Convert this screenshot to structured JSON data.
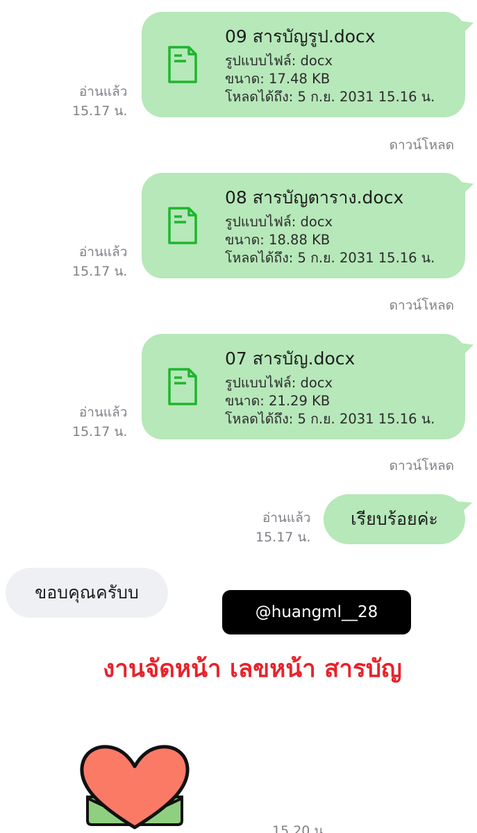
{
  "messages": {
    "files": [
      {
        "title": "09 สารบัญรูป.docx",
        "format": "รูปแบบไฟล์: docx",
        "size": "ขนาด: 17.48 KB",
        "expiry": "โหลดได้ถึง: 5 ก.ย. 2031 15.16 น.",
        "read_status": "อ่านแล้ว",
        "read_time": "15.17 น.",
        "download_label": "ดาวน์โหลด"
      },
      {
        "title": "08 สารบัญตาราง.docx",
        "format": "รูปแบบไฟล์: docx",
        "size": "ขนาด: 18.88 KB",
        "expiry": "โหลดได้ถึง: 5 ก.ย. 2031 15.16 น.",
        "read_status": "อ่านแล้ว",
        "read_time": "15.17 น.",
        "download_label": "ดาวน์โหลด"
      },
      {
        "title": "07 สารบัญ.docx",
        "format": "รูปแบบไฟล์: docx",
        "size": "ขนาด: 21.29 KB",
        "expiry": "โหลดได้ถึง: 5 ก.ย. 2031 15.16 น.",
        "read_status": "อ่านแล้ว",
        "read_time": "15.17 น.",
        "download_label": "ดาวน์โหลด"
      }
    ],
    "outgoing_text": {
      "text": "เรียบร้อยค่ะ",
      "read_status": "อ่านแล้ว",
      "read_time": "15.17 น."
    },
    "incoming_text": {
      "text": "ขอบคุณครับบ"
    },
    "sticker": {
      "icon": "heart-envelope-sticker",
      "time": "15.20 น."
    }
  },
  "overlay": {
    "handle": "@huangml__28",
    "headline": "งานจัดหน้า เลขหน้า สารบัญ"
  },
  "colors": {
    "bubble_green": "#b6e8b9",
    "bubble_grey": "#eef0f3",
    "icon_green": "#1fb52e",
    "headline_red": "#e8232b",
    "meta_grey": "#7f8187"
  }
}
